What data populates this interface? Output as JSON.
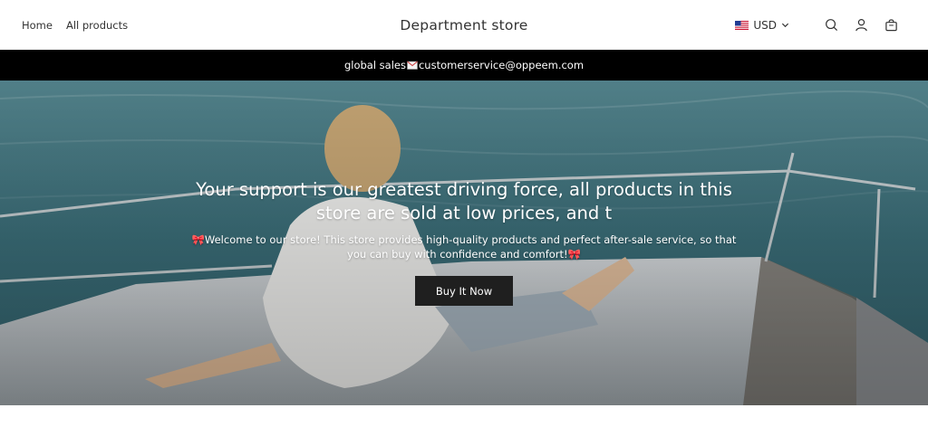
{
  "header": {
    "nav": [
      {
        "label": "Home"
      },
      {
        "label": "All products"
      }
    ],
    "brand": "Department store",
    "currency": "USD",
    "icons": [
      "search-icon",
      "account-icon",
      "cart-icon"
    ]
  },
  "announcement": {
    "prefix": "global sales",
    "email": "customerservice@oppeem.com"
  },
  "hero": {
    "title": "Your support is our greatest driving force, all products in this store are sold at low prices, and t",
    "subtitle": "🎀Welcome to our store! This store provides high-quality products and perfect after-sale service, so that you can buy with confidence and comfort!🎀",
    "button": "Buy It Now"
  },
  "colors": {
    "announcement_bg": "#000000",
    "button_bg": "#1f1f1f",
    "text": "#333333"
  }
}
